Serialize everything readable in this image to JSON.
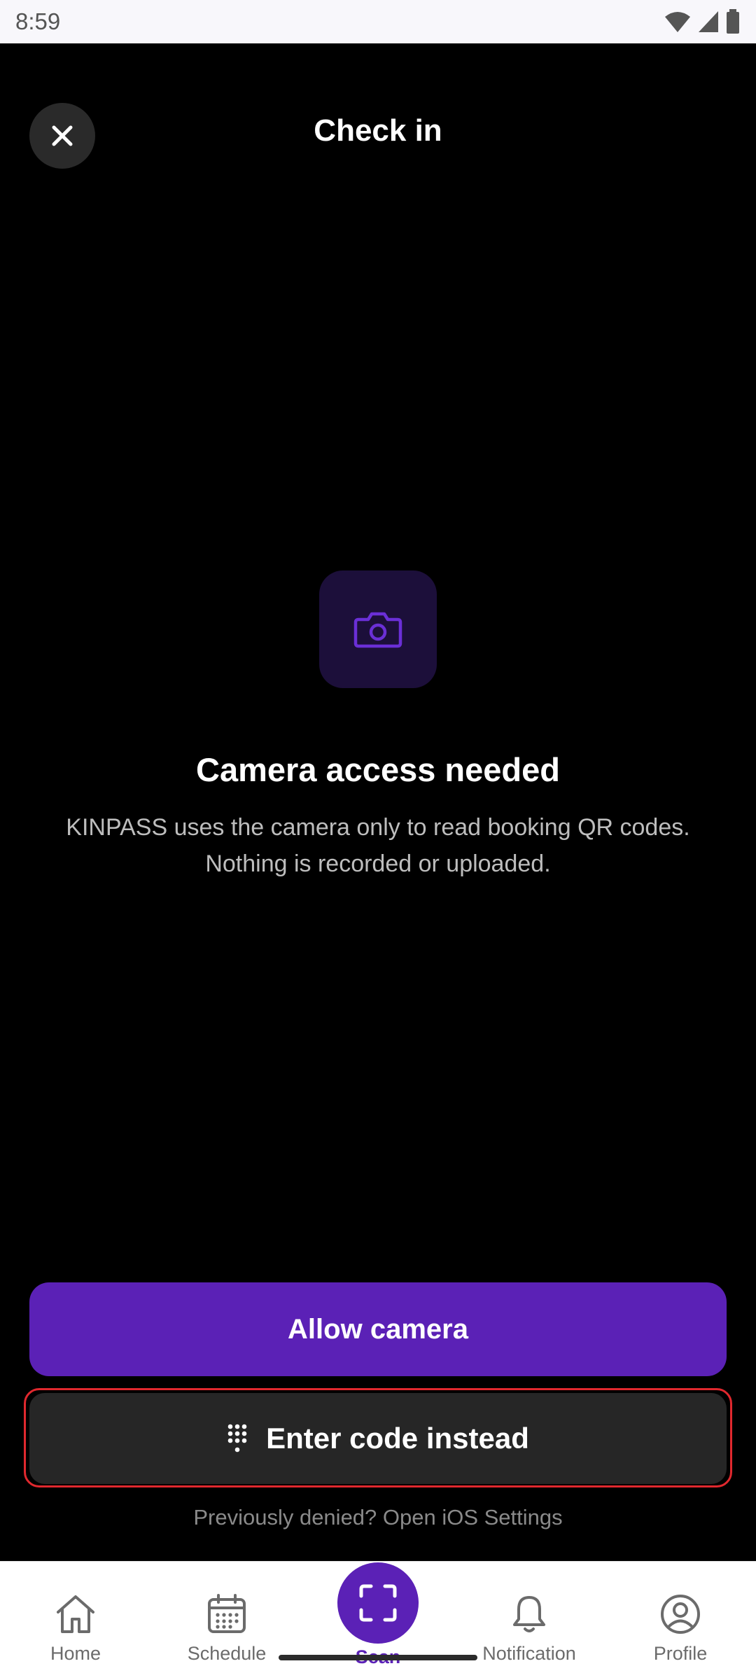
{
  "status_bar": {
    "time": "8:59"
  },
  "header": {
    "title": "Check in",
    "close_icon": "close-icon"
  },
  "permission": {
    "icon": "camera-icon",
    "title": "Camera access needed",
    "body_line1": "KINPASS uses the camera only to read booking QR codes.",
    "body_line2": "Nothing is recorded or uploaded."
  },
  "actions": {
    "allow_label": "Allow camera",
    "enter_code_label": "Enter code instead",
    "settings_hint": "Previously denied? Open iOS Settings"
  },
  "nav": {
    "items": [
      {
        "label": "Home",
        "icon": "home-icon"
      },
      {
        "label": "Schedule",
        "icon": "calendar-icon"
      },
      {
        "label": "Scan",
        "icon": "scan-icon",
        "active": true
      },
      {
        "label": "Notification",
        "icon": "bell-icon"
      },
      {
        "label": "Profile",
        "icon": "profile-icon"
      }
    ]
  },
  "colors": {
    "accent": "#5b21b6",
    "background": "#000000",
    "secondary_button": "#262626",
    "highlight_outline": "#e0282e"
  }
}
